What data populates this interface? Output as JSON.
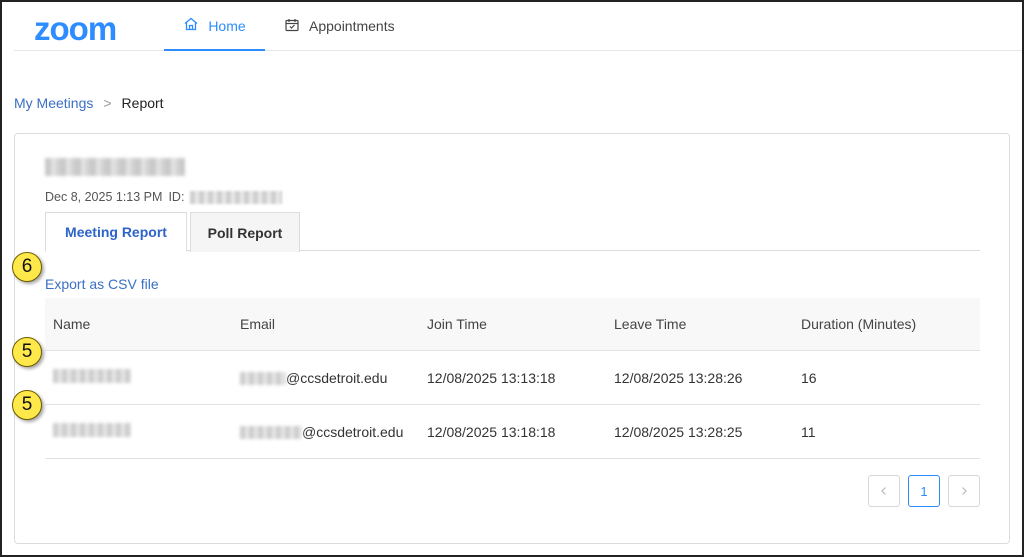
{
  "header": {
    "logo_text": "zoom",
    "nav": [
      {
        "label": "Home",
        "icon": "home-icon",
        "active": true
      },
      {
        "label": "Appointments",
        "icon": "calendar-icon",
        "active": false
      }
    ]
  },
  "breadcrumb": {
    "parent": "My Meetings",
    "separator": ">",
    "current": "Report"
  },
  "meeting": {
    "date_time": "Dec 8, 2025 1:13 PM",
    "id_label": "ID:"
  },
  "tabs": [
    {
      "label": "Meeting Report",
      "active": true
    },
    {
      "label": "Poll Report",
      "active": false
    }
  ],
  "export_label": "Export as CSV file",
  "table": {
    "columns": [
      "Name",
      "Email",
      "Join Time",
      "Leave Time",
      "Duration (Minutes)"
    ],
    "rows": [
      {
        "email_domain": "@ccsdetroit.edu",
        "join": "12/08/2025 13:13:18",
        "leave": "12/08/2025 13:28:26",
        "duration": "16"
      },
      {
        "email_domain": "@ccsdetroit.edu",
        "join": "12/08/2025 13:18:18",
        "leave": "12/08/2025 13:28:25",
        "duration": "11"
      }
    ]
  },
  "pagination": {
    "prev": "<",
    "current_page": "1",
    "next": ">"
  },
  "callouts": [
    "6",
    "5",
    "5"
  ],
  "colors": {
    "brand": "#2d8cff",
    "link": "#3a6fc4",
    "callout": "#ffe94a"
  }
}
